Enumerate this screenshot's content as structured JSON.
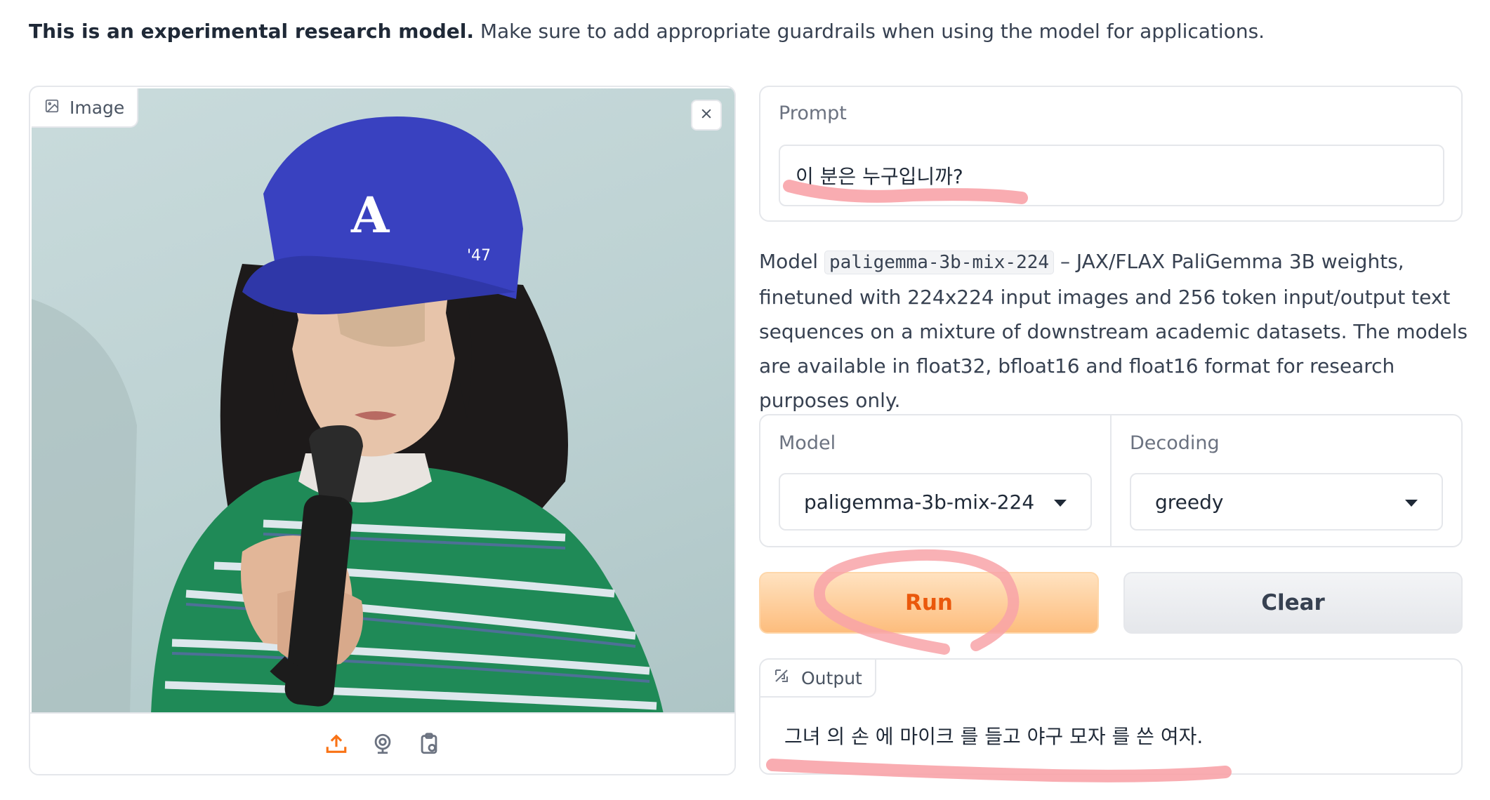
{
  "disclaimer": {
    "bold": "This is an experimental research model.",
    "rest": " Make sure to add appropriate guardrails when using the model for applications."
  },
  "image_panel": {
    "label": "Image",
    "icons": [
      "image-icon",
      "close-icon",
      "upload-icon",
      "webcam-icon",
      "clipboard-icon"
    ]
  },
  "prompt": {
    "label": "Prompt",
    "value": "이 분은 누구입니까?"
  },
  "description": {
    "prefix": "Model ",
    "model_code": "paligemma-3b-mix-224",
    "suffix": " – JAX/FLAX PaliGemma 3B weights, finetuned with 224x224 input images and 256 token input/output text sequences on a mixture of downstream academic datasets. The models are available in float32, bfloat16 and float16 format for research purposes only."
  },
  "model_select": {
    "label": "Model",
    "value": "paligemma-3b-mix-224"
  },
  "decoding_select": {
    "label": "Decoding",
    "value": "greedy"
  },
  "buttons": {
    "run": "Run",
    "clear": "Clear"
  },
  "output": {
    "label": "Output",
    "value": "그녀 의 손 에 마이크 를 들고 야구 모자 를 쓴 여자."
  },
  "colors": {
    "accent_orange": "#ea580c",
    "annotation_red": "#f8a3a8"
  }
}
